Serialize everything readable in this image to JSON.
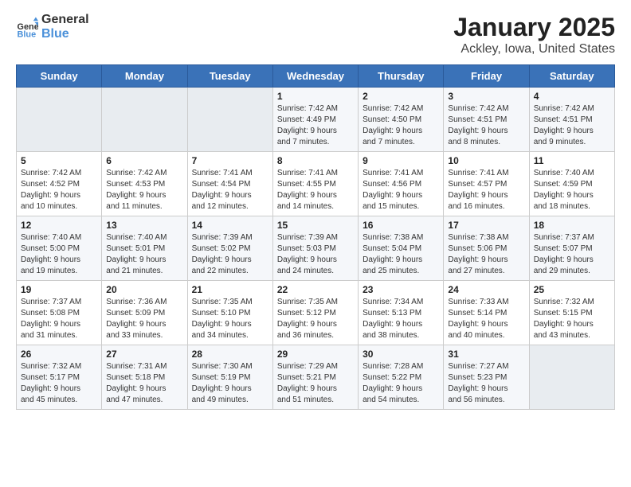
{
  "logo": {
    "name_part1": "General",
    "name_part2": "Blue"
  },
  "title": "January 2025",
  "subtitle": "Ackley, Iowa, United States",
  "weekdays": [
    "Sunday",
    "Monday",
    "Tuesday",
    "Wednesday",
    "Thursday",
    "Friday",
    "Saturday"
  ],
  "weeks": [
    [
      {
        "day": "",
        "info": ""
      },
      {
        "day": "",
        "info": ""
      },
      {
        "day": "",
        "info": ""
      },
      {
        "day": "1",
        "info": "Sunrise: 7:42 AM\nSunset: 4:49 PM\nDaylight: 9 hours\nand 7 minutes."
      },
      {
        "day": "2",
        "info": "Sunrise: 7:42 AM\nSunset: 4:50 PM\nDaylight: 9 hours\nand 7 minutes."
      },
      {
        "day": "3",
        "info": "Sunrise: 7:42 AM\nSunset: 4:51 PM\nDaylight: 9 hours\nand 8 minutes."
      },
      {
        "day": "4",
        "info": "Sunrise: 7:42 AM\nSunset: 4:51 PM\nDaylight: 9 hours\nand 9 minutes."
      }
    ],
    [
      {
        "day": "5",
        "info": "Sunrise: 7:42 AM\nSunset: 4:52 PM\nDaylight: 9 hours\nand 10 minutes."
      },
      {
        "day": "6",
        "info": "Sunrise: 7:42 AM\nSunset: 4:53 PM\nDaylight: 9 hours\nand 11 minutes."
      },
      {
        "day": "7",
        "info": "Sunrise: 7:41 AM\nSunset: 4:54 PM\nDaylight: 9 hours\nand 12 minutes."
      },
      {
        "day": "8",
        "info": "Sunrise: 7:41 AM\nSunset: 4:55 PM\nDaylight: 9 hours\nand 14 minutes."
      },
      {
        "day": "9",
        "info": "Sunrise: 7:41 AM\nSunset: 4:56 PM\nDaylight: 9 hours\nand 15 minutes."
      },
      {
        "day": "10",
        "info": "Sunrise: 7:41 AM\nSunset: 4:57 PM\nDaylight: 9 hours\nand 16 minutes."
      },
      {
        "day": "11",
        "info": "Sunrise: 7:40 AM\nSunset: 4:59 PM\nDaylight: 9 hours\nand 18 minutes."
      }
    ],
    [
      {
        "day": "12",
        "info": "Sunrise: 7:40 AM\nSunset: 5:00 PM\nDaylight: 9 hours\nand 19 minutes."
      },
      {
        "day": "13",
        "info": "Sunrise: 7:40 AM\nSunset: 5:01 PM\nDaylight: 9 hours\nand 21 minutes."
      },
      {
        "day": "14",
        "info": "Sunrise: 7:39 AM\nSunset: 5:02 PM\nDaylight: 9 hours\nand 22 minutes."
      },
      {
        "day": "15",
        "info": "Sunrise: 7:39 AM\nSunset: 5:03 PM\nDaylight: 9 hours\nand 24 minutes."
      },
      {
        "day": "16",
        "info": "Sunrise: 7:38 AM\nSunset: 5:04 PM\nDaylight: 9 hours\nand 25 minutes."
      },
      {
        "day": "17",
        "info": "Sunrise: 7:38 AM\nSunset: 5:06 PM\nDaylight: 9 hours\nand 27 minutes."
      },
      {
        "day": "18",
        "info": "Sunrise: 7:37 AM\nSunset: 5:07 PM\nDaylight: 9 hours\nand 29 minutes."
      }
    ],
    [
      {
        "day": "19",
        "info": "Sunrise: 7:37 AM\nSunset: 5:08 PM\nDaylight: 9 hours\nand 31 minutes."
      },
      {
        "day": "20",
        "info": "Sunrise: 7:36 AM\nSunset: 5:09 PM\nDaylight: 9 hours\nand 33 minutes."
      },
      {
        "day": "21",
        "info": "Sunrise: 7:35 AM\nSunset: 5:10 PM\nDaylight: 9 hours\nand 34 minutes."
      },
      {
        "day": "22",
        "info": "Sunrise: 7:35 AM\nSunset: 5:12 PM\nDaylight: 9 hours\nand 36 minutes."
      },
      {
        "day": "23",
        "info": "Sunrise: 7:34 AM\nSunset: 5:13 PM\nDaylight: 9 hours\nand 38 minutes."
      },
      {
        "day": "24",
        "info": "Sunrise: 7:33 AM\nSunset: 5:14 PM\nDaylight: 9 hours\nand 40 minutes."
      },
      {
        "day": "25",
        "info": "Sunrise: 7:32 AM\nSunset: 5:15 PM\nDaylight: 9 hours\nand 43 minutes."
      }
    ],
    [
      {
        "day": "26",
        "info": "Sunrise: 7:32 AM\nSunset: 5:17 PM\nDaylight: 9 hours\nand 45 minutes."
      },
      {
        "day": "27",
        "info": "Sunrise: 7:31 AM\nSunset: 5:18 PM\nDaylight: 9 hours\nand 47 minutes."
      },
      {
        "day": "28",
        "info": "Sunrise: 7:30 AM\nSunset: 5:19 PM\nDaylight: 9 hours\nand 49 minutes."
      },
      {
        "day": "29",
        "info": "Sunrise: 7:29 AM\nSunset: 5:21 PM\nDaylight: 9 hours\nand 51 minutes."
      },
      {
        "day": "30",
        "info": "Sunrise: 7:28 AM\nSunset: 5:22 PM\nDaylight: 9 hours\nand 54 minutes."
      },
      {
        "day": "31",
        "info": "Sunrise: 7:27 AM\nSunset: 5:23 PM\nDaylight: 9 hours\nand 56 minutes."
      },
      {
        "day": "",
        "info": ""
      }
    ]
  ]
}
